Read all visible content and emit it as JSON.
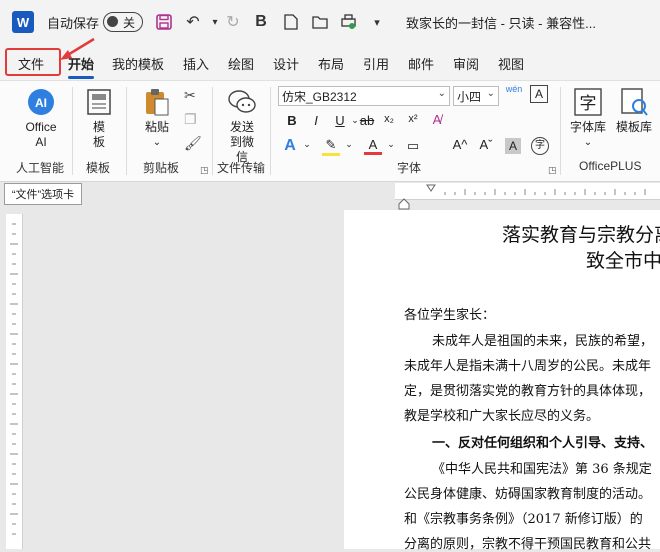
{
  "titlebar": {
    "autosave_label": "自动保存",
    "autosave_state": "关",
    "doc_title": "致家长的一封信 - 只读 - 兼容性..."
  },
  "menu": {
    "tabs": [
      "文件",
      "开始",
      "我的模板",
      "插入",
      "绘图",
      "设计",
      "布局",
      "引用",
      "邮件",
      "审阅",
      "视图"
    ],
    "active_tab": "开始"
  },
  "ribbon": {
    "office_ai": "Office AI",
    "group_ai": "人工智能",
    "template_btn": "模板",
    "group_template": "模板",
    "paste_btn": "粘贴",
    "group_clipboard": "剪贴板",
    "send_wechat": "发送到微信",
    "group_transfer": "文件传输",
    "font_name": "仿宋_GB2312",
    "font_size": "小四",
    "group_font": "字体",
    "fontlib_btn": "字体库",
    "templatelib_btn": "模板库",
    "group_officeplus": "OfficePLUS",
    "accent_color": "#185abd"
  },
  "tooltip": "“文件”选项卡",
  "document": {
    "title_line1": "落实教育与宗教分离",
    "title_line2": "致全市中",
    "greeting": "各位学生家长：",
    "p1": "未成年人是祖国的未来，民族的希望，",
    "p2": "未成年人是指未满十八周岁的公民。未成年",
    "p3": "定，是贯彻落实党的教育方针的具体体现，",
    "p4": "教是学校和广大家长应尽的义务。",
    "h_section": "一、反对任何组织和个人引导、支持、",
    "p5": "《中华人民共和国宪法》第 36 条规定",
    "p6": "公民身体健康、妨碍国家教育制度的活动。",
    "p7": "和《宗教事务条例》（2017 新修订版）的",
    "p8": "分离的原则，宗教不得干预国民教育和公共"
  }
}
